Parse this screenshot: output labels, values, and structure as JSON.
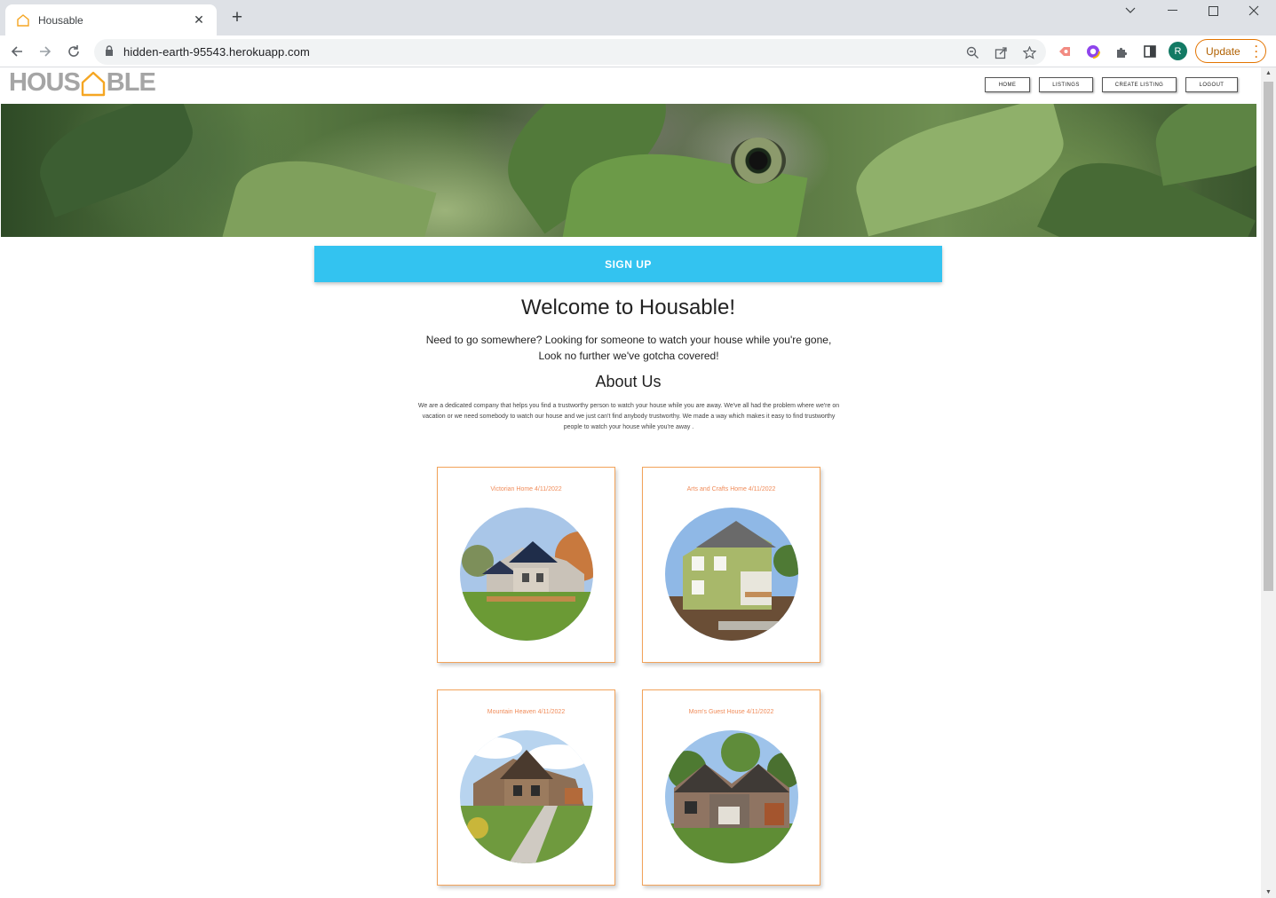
{
  "browser": {
    "tab_title": "Housable",
    "url": "hidden-earth-95543.herokuapp.com",
    "profile_initial": "R",
    "update_label": "Update",
    "accent_color": "#e37400"
  },
  "site": {
    "logo_left": "HOUS",
    "logo_right": "BLE",
    "nav": [
      "HOME",
      "LISTINGS",
      "CREATE LISTING",
      "LOGOUT"
    ],
    "signup_label": "SIGN UP",
    "welcome_title": "Welcome to Housable!",
    "intro": "Need to go somewhere? Looking for someone to watch your house while you're gone, Look no further we've gotcha covered!",
    "about_title": "About Us",
    "about_text": "We are a dedicated company that helps you find a trustworthy person to watch your house while you are away. We've all had the problem where we're on vacation or we need somebody to watch our house and we just can't find anybody trustworthy. We made a way which makes it easy to find trustworthy people to watch your house while you're away .",
    "primary_color": "#33c3f0",
    "card_border_color": "#f2a35a"
  },
  "listings": [
    {
      "title": "Victorian Home 4/11/2022"
    },
    {
      "title": "Arts and Crafts Home 4/11/2022"
    },
    {
      "title": "Mountain Heaven 4/11/2022"
    },
    {
      "title": "Mom's Guest House 4/11/2022"
    }
  ]
}
